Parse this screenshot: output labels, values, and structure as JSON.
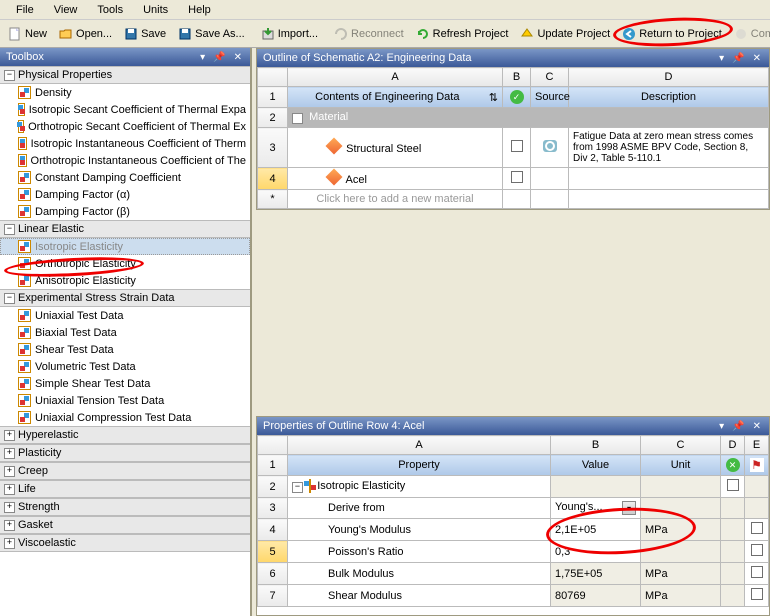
{
  "menu": [
    "File",
    "View",
    "Tools",
    "Units",
    "Help"
  ],
  "toolbar": {
    "new": "New",
    "open": "Open...",
    "save": "Save",
    "saveas": "Save As...",
    "import": "Import...",
    "reconnect": "Reconnect",
    "refresh": "Refresh Project",
    "update": "Update Project",
    "return": "Return to Project",
    "compact": "Com"
  },
  "toolbox": {
    "title": "Toolbox",
    "categories": [
      {
        "name": "Physical Properties",
        "open": true,
        "items": [
          "Density",
          "Isotropic Secant Coefficient of Thermal Expa",
          "Orthotropic Secant Coefficient of Thermal Ex",
          "Isotropic Instantaneous Coefficient of Therm",
          "Orthotropic Instantaneous Coefficient of The",
          "Constant Damping Coefficient",
          "Damping Factor (α)",
          "Damping Factor (β)"
        ]
      },
      {
        "name": "Linear Elastic",
        "open": true,
        "items": [
          "Isotropic Elasticity",
          "Orthotropic Elasticity",
          "Anisotropic Elasticity"
        ]
      },
      {
        "name": "Experimental Stress Strain Data",
        "open": true,
        "items": [
          "Uniaxial Test Data",
          "Biaxial Test Data",
          "Shear Test Data",
          "Volumetric Test Data",
          "Simple Shear Test Data",
          "Uniaxial Tension Test Data",
          "Uniaxial Compression Test Data"
        ]
      },
      {
        "name": "Hyperelastic",
        "open": false,
        "items": []
      },
      {
        "name": "Plasticity",
        "open": false,
        "items": []
      },
      {
        "name": "Creep",
        "open": false,
        "items": []
      },
      {
        "name": "Life",
        "open": false,
        "items": []
      },
      {
        "name": "Strength",
        "open": false,
        "items": []
      },
      {
        "name": "Gasket",
        "open": false,
        "items": []
      },
      {
        "name": "Viscoelastic",
        "open": false,
        "items": []
      }
    ]
  },
  "outline": {
    "title": "Outline of Schematic A2: Engineering Data",
    "cols": {
      "A": "A",
      "B": "B",
      "C": "C",
      "D": "D"
    },
    "headers": {
      "contents": "Contents of Engineering Data",
      "source": "Source",
      "desc": "Description"
    },
    "matHeader": "Material",
    "rows": [
      {
        "n": "3",
        "name": "Structural Steel",
        "desc": "Fatigue Data at zero mean stress comes from 1998 ASME BPV Code, Section 8, Div 2, Table 5-110.1"
      },
      {
        "n": "4",
        "name": "Acel",
        "desc": "",
        "selected": true
      }
    ],
    "addText": "Click here to add a new material"
  },
  "props": {
    "title": "Properties of Outline Row 4: Acel",
    "cols": {
      "A": "A",
      "B": "B",
      "C": "C",
      "D": "D",
      "E": "E"
    },
    "headers": {
      "prop": "Property",
      "val": "Value",
      "unit": "Unit"
    },
    "rows": [
      {
        "n": "2",
        "prop": "Isotropic Elasticity",
        "val": "",
        "unit": "",
        "header": true
      },
      {
        "n": "3",
        "prop": "Derive from",
        "val": "Young's...",
        "unit": "",
        "dropdown": true
      },
      {
        "n": "4",
        "prop": "Young's Modulus",
        "val": "2,1E+05",
        "unit": "MPa"
      },
      {
        "n": "5",
        "prop": "Poisson's Ratio",
        "val": "0,3",
        "unit": "",
        "hl": true
      },
      {
        "n": "6",
        "prop": "Bulk Modulus",
        "val": "1,75E+05",
        "unit": "MPa",
        "ro": true
      },
      {
        "n": "7",
        "prop": "Shear Modulus",
        "val": "80769",
        "unit": "MPa",
        "ro": true
      }
    ]
  }
}
